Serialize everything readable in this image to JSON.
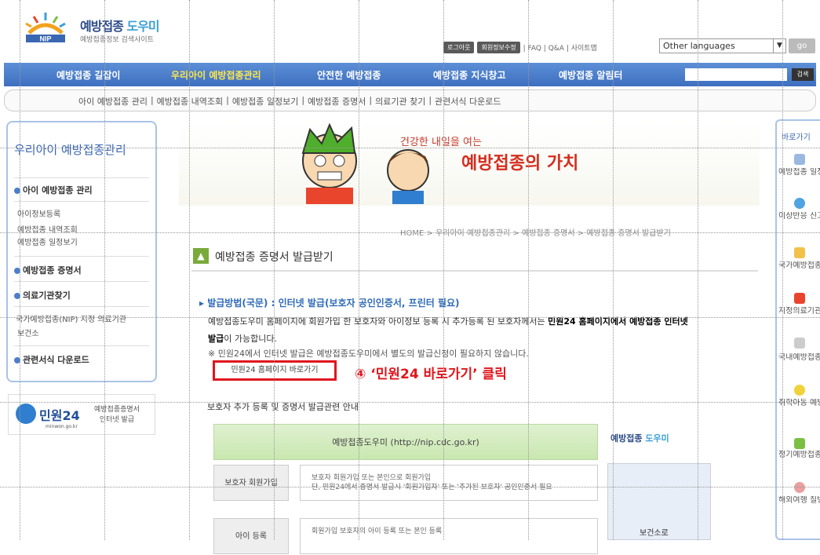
{
  "header": {
    "logo_title_a": "예방접종",
    "logo_title_b": "도우미",
    "logo_badge": "NIP",
    "logo_sub": "예방접종정보 검색사이트",
    "util_btn1": "로그아웃",
    "util_btn2": "회원정보수정",
    "util_links": "| FAQ | Q&A | 사이트맵",
    "lang_select": "Other languages",
    "go_label": "go"
  },
  "nav": {
    "items": [
      "예방접종 길잡이",
      "우리아이 예방접종관리",
      "안전한 예방접종",
      "예방접종 지식창고",
      "예방접종 알림터"
    ],
    "search_btn": "검색"
  },
  "subnav": {
    "items": [
      "아이 예방접종 관리",
      "|",
      "예방접종 내역조회",
      "|",
      "예방접종 일정보기",
      "|",
      "예방접종 증명서",
      "|",
      "의료기관 찾기",
      "|",
      "관련서식 다운로드"
    ]
  },
  "left": {
    "title": "우리아이 예방접종관리",
    "sec1": "아이 예방접종 관리",
    "sub1": [
      "아이정보등록",
      "예방접종 내역조회",
      "예방접종 일정보기"
    ],
    "sec2": "예방접종 증명서",
    "sec3": "의료기관찾기",
    "sub3": [
      "국가예방접종(NIP) 지정 의료기관",
      "보건소"
    ],
    "sec4": "관련서식 다운로드",
    "banner_title": "민원24",
    "banner_url": "minwon.go.kr",
    "banner_desc1": "예방접종증명서",
    "banner_desc2": "인터넷 발급"
  },
  "banner": {
    "line1": "건강한 내일을 여는",
    "line2": "예방접종의 가치"
  },
  "content": {
    "breadcrumb": "HOME > 우리아이 예방접종관리 > 예방접종 증명서 > 예방접종 증명서 발급받기",
    "page_title": "예방접종 증명서 발급받기",
    "method": "▸ 발급방법(국문) : 인터넷 발급(보호자 공인인증서, 프린터 필요)",
    "para1_a": "예방접종도우미 홈페이지에 회원가입 한 보호자와 아이정보 등록 시 추가등록 된 보호자께서는 ",
    "para1_b": "민원24 홈페이지에서 예방접종 인터넷 발급",
    "para1_c": "이 가능합니다.",
    "note": "※ 민원24에서 인터넷 발급은 예방접종도우미에서 별도의 발급신청이 필요하지 않습니다.",
    "minwon_btn": "민원24 홈페이지 바로가기",
    "callout": "④ ‘민원24 바로가기’ 클릭",
    "guide_title": "보호자 추가 등록 및 증명서 발급관련 안내",
    "green_box": "예방접종도우미 (http://nip.cdc.go.kr)",
    "nip_small_a": "예방접종",
    "nip_small_b": "도우미",
    "flow1_label": "보호자 회원가입",
    "flow1_desc1": "보호자 회원가입 또는 본인으로 회원가입",
    "flow1_desc2": "단, 민원24에서 증명서 발급시 '회원가입자' 또는 '추가된 보호자' 공인인증서 필요",
    "flow2_label": "아이 등록",
    "flow2_desc1": "회원가입 보호자의 아이 등록 또는 본인 등록",
    "health_label": "보건소로"
  },
  "right": {
    "title": "바로가기",
    "items": [
      "예방접종 일정보기",
      "이상반응 신고하기",
      "국가예방접종 지원사업",
      "지정의료기관 찾기",
      "국내예방접종 백신현황",
      "취학아동 예방접종 확인사업",
      "정기예방접종 사전알림안내",
      "해외여행 질병정보 센터"
    ]
  }
}
